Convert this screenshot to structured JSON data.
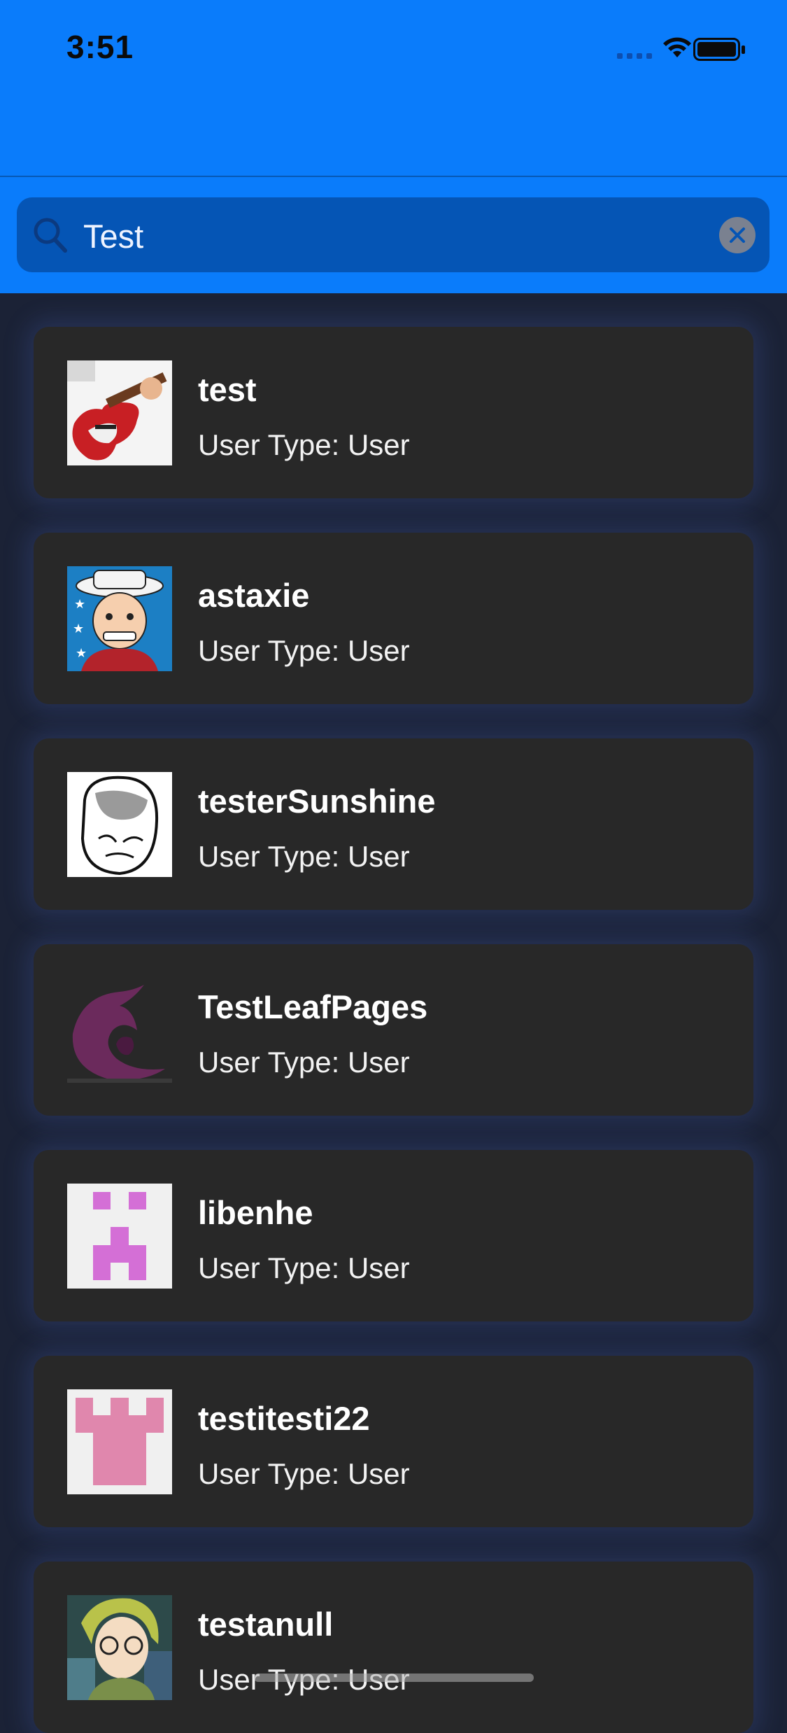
{
  "status_bar": {
    "time": "3:51",
    "icons": [
      "cellular-signal-icon",
      "wifi-icon",
      "battery-icon"
    ]
  },
  "search": {
    "value": "Test",
    "icon": "search-icon",
    "clear_icon": "clear-icon"
  },
  "colors": {
    "header": "#0a7cfb",
    "search_field": "#0555b5",
    "background": "#1b2236",
    "card": "#282828"
  },
  "results": [
    {
      "name": "test",
      "user_type": "User Type: User",
      "avatar": "guitar-avatar"
    },
    {
      "name": "astaxie",
      "user_type": "User Type: User",
      "avatar": "cartoon-hat-avatar"
    },
    {
      "name": "testerSunshine",
      "user_type": "User Type: User",
      "avatar": "meme-face-avatar"
    },
    {
      "name": "TestLeafPages",
      "user_type": "User Type: User",
      "avatar": "swirl-logo-avatar"
    },
    {
      "name": "libenhe",
      "user_type": "User Type: User",
      "avatar": "identicon-avatar"
    },
    {
      "name": "testitesti22",
      "user_type": "User Type: User",
      "avatar": "identicon-avatar"
    },
    {
      "name": "testanull",
      "user_type": "User Type: User",
      "avatar": "anime-avatar"
    }
  ]
}
